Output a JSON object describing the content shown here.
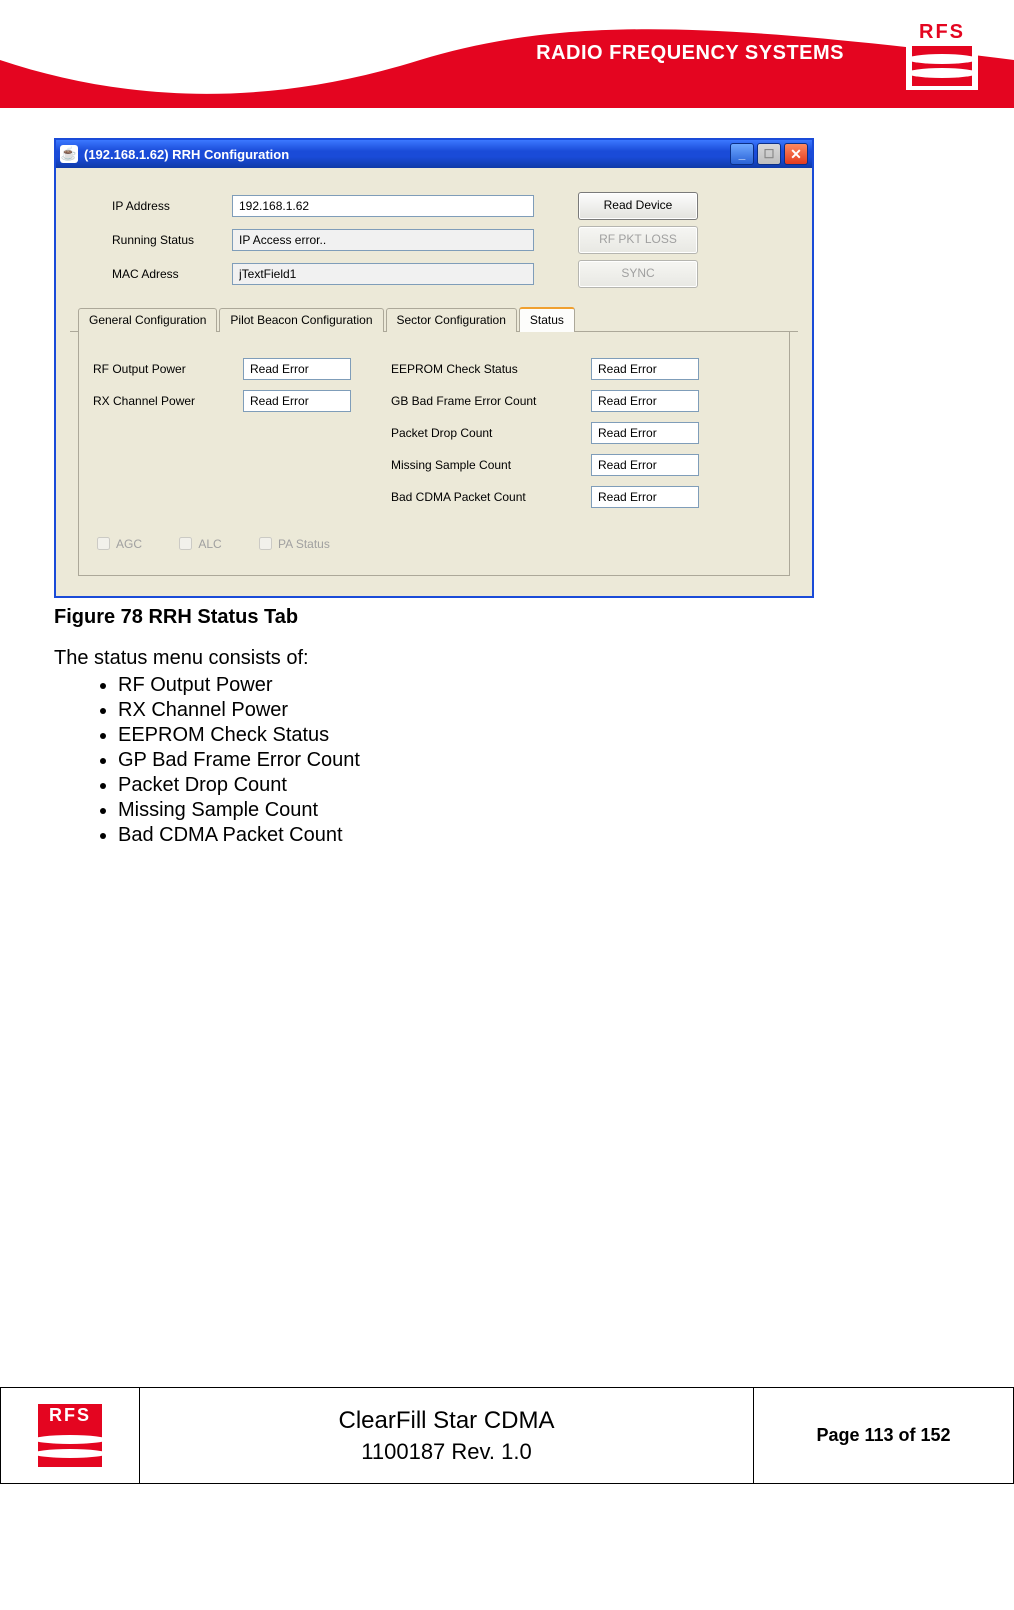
{
  "header": {
    "brand_text": "RADIO FREQUENCY SYSTEMS",
    "logo_text": "RFS"
  },
  "window": {
    "title": "(192.168.1.62) RRH Configuration",
    "form": {
      "ip_label": "IP Address",
      "ip_value": "192.168.1.62",
      "running_label": "Running Status",
      "running_value": "IP Access error..",
      "mac_label": "MAC Adress",
      "mac_value": "jTextField1"
    },
    "buttons": {
      "read_device": "Read Device",
      "rf_pkt_loss": "RF PKT LOSS",
      "sync": "SYNC"
    },
    "tabs": {
      "general": "General Configuration",
      "pilot": "Pilot Beacon Configuration",
      "sector": "Sector Configuration",
      "status": "Status"
    },
    "status": {
      "rf_output_power_label": "RF Output Power",
      "rf_output_power_value": "Read Error",
      "rx_channel_power_label": "RX Channel Power",
      "rx_channel_power_value": "Read Error",
      "eeprom_label": "EEPROM Check Status",
      "eeprom_value": "Read Error",
      "gb_bad_frame_label": "GB Bad Frame Error Count",
      "gb_bad_frame_value": "Read Error",
      "packet_drop_label": "Packet Drop Count",
      "packet_drop_value": "Read Error",
      "missing_sample_label": "Missing Sample Count",
      "missing_sample_value": "Read Error",
      "bad_cdma_label": "Bad CDMA Packet Count",
      "bad_cdma_value": "Read Error"
    },
    "checkboxes": {
      "agc": "AGC",
      "alc": "ALC",
      "pa": "PA Status"
    }
  },
  "caption": "Figure 78 RRH Status Tab",
  "intro": "The status menu consists of:",
  "bullets": {
    "b0": "RF Output Power",
    "b1": "RX Channel Power",
    "b2": "EEPROM Check Status",
    "b3": "GP Bad Frame Error Count",
    "b4": "Packet Drop Count",
    "b5": "Missing Sample Count",
    "b6": "Bad CDMA Packet Count"
  },
  "footer": {
    "logo_text": "RFS",
    "product": "ClearFill Star CDMA",
    "doc": "1100187 Rev. 1.0",
    "page": "Page 113 of 152"
  }
}
